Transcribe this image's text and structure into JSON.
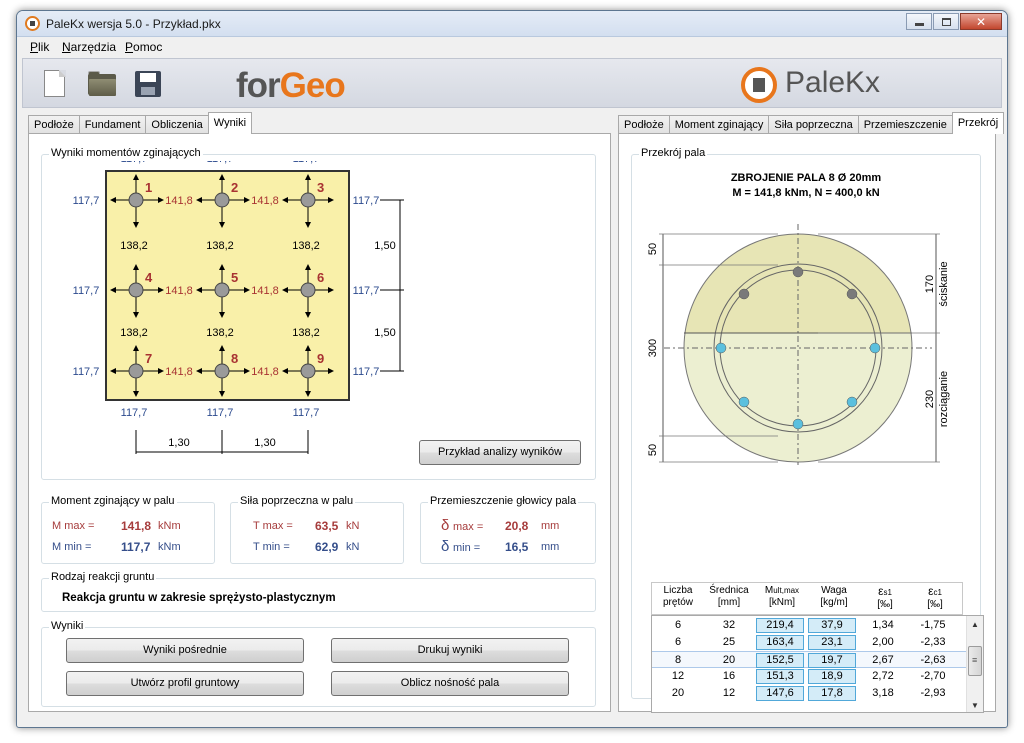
{
  "window": {
    "title": "PaleKx wersja 5.0 - Przykład.pkx"
  },
  "menu": {
    "items": [
      {
        "label": "Plik"
      },
      {
        "label": "Narzędzia"
      },
      {
        "label": "Pomoc"
      }
    ]
  },
  "toolbar": {
    "brand_logo": {
      "part1": "for",
      "part2": "Geo"
    },
    "product_logo": "PaleKx"
  },
  "left_panel": {
    "tabs": [
      "Podłoże",
      "Fundament",
      "Obliczenia",
      "Wyniki"
    ],
    "active_tab": "Wyniki",
    "moments_group": {
      "title": "Wyniki momentów zginających",
      "piles": [
        "1",
        "2",
        "3",
        "4",
        "5",
        "6",
        "7",
        "8",
        "9"
      ],
      "horizontal_moment": "141,8",
      "vertical_moment": "138,2",
      "edge_moment": "117,7",
      "spacing_y": "1,50",
      "spacing_x": "1,30",
      "example_button": "Przykład analizy wyników"
    },
    "moment_box": {
      "title": "Moment zginający w palu",
      "max_label": "M max =",
      "max_value": "141,8",
      "min_label": "M min =",
      "min_value": "117,7",
      "unit": "kNm"
    },
    "shear_box": {
      "title": "Siła poprzeczna w palu",
      "max_label": "T max =",
      "max_value": "63,5",
      "min_label": "T min =",
      "min_value": "62,9",
      "unit": "kN"
    },
    "displacement_box": {
      "title": "Przemieszczenie głowicy pala",
      "max_symbol": "δ",
      "max_sub": "max =",
      "max_value": "20,8",
      "min_symbol": "δ",
      "min_sub": "min =",
      "min_value": "16,5",
      "unit": "mm"
    },
    "soil_reaction": {
      "title": "Rodzaj reakcji gruntu",
      "value": "Reakcja gruntu w zakresie sprężysto-plastycznym"
    },
    "results": {
      "title": "Wyniki",
      "btn_intermediate": "Wyniki pośrednie",
      "btn_print": "Drukuj wyniki",
      "btn_profile": "Utwórz profil gruntowy",
      "btn_capacity": "Oblicz nośność pala"
    }
  },
  "right_panel": {
    "tabs": [
      "Podłoże",
      "Moment zginający",
      "Siła poprzeczna",
      "Przemieszczenie",
      "Przekrój"
    ],
    "active_tab": "Przekrój",
    "section_group": {
      "title": "Przekrój pala"
    },
    "heading_line1": "ZBROJENIE PALA 8 Ø 20mm",
    "heading_line2": "M = 141,8 kNm,  N = 400,0 kN",
    "dims": {
      "top": "50",
      "total": "300",
      "bottom": "50",
      "compression": "170",
      "tension": "230"
    },
    "zone_labels": {
      "compression": "ściskanie",
      "tension": "rozciąganie"
    },
    "colors": {
      "compression_zone": "#e7e5b5",
      "tension_zone": "#ecefd1",
      "bar_compression": "#7a7a7a",
      "bar_tension": "#5bc0de"
    },
    "table": {
      "headers": [
        {
          "line1": "Liczba",
          "line2": "prętów"
        },
        {
          "line1": "Średnica",
          "line2": "[mm]"
        },
        {
          "line1": "M",
          "sub": "ult,max",
          "line2": "[kNm]"
        },
        {
          "line1": "Waga",
          "line2": "[kg/m]"
        },
        {
          "line1": "ε",
          "sub": "s1",
          "line2": "[‰]"
        },
        {
          "line1": "ε",
          "sub": "c1",
          "line2": "[‰]"
        }
      ],
      "rows": [
        [
          "6",
          "32",
          "219,4",
          "37,9",
          "1,34",
          "-1,75"
        ],
        [
          "6",
          "25",
          "163,4",
          "23,1",
          "2,00",
          "-2,33"
        ],
        [
          "8",
          "20",
          "152,5",
          "19,7",
          "2,67",
          "-2,63"
        ],
        [
          "12",
          "16",
          "151,3",
          "18,9",
          "2,72",
          "-2,70"
        ],
        [
          "20",
          "12",
          "147,6",
          "17,8",
          "3,18",
          "-2,93"
        ]
      ],
      "selected_row": 2
    }
  }
}
